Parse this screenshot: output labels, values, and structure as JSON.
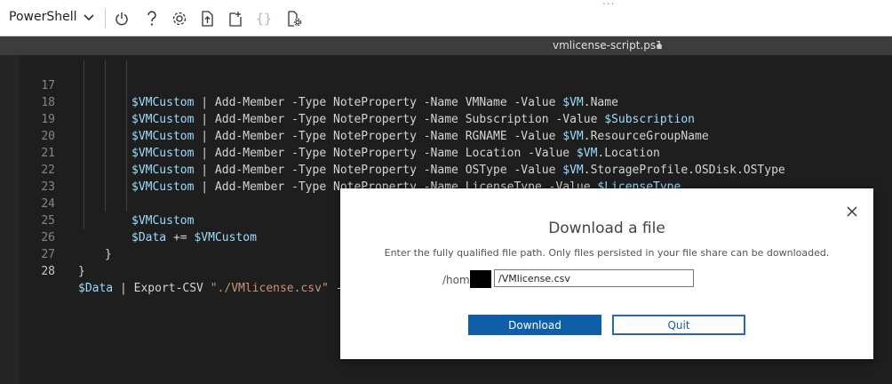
{
  "toolbar": {
    "shell_label": "PowerShell",
    "icons": [
      "power-icon",
      "help-icon",
      "settings-icon",
      "upload-file-icon",
      "download-file-icon",
      "braces-icon",
      "open-editor-icon"
    ]
  },
  "editor": {
    "tab_title": "vmlicense-script.ps1",
    "lines": [
      {
        "num": "17",
        "text": "$VMCustom | Add-Member -Type NoteProperty -Name VMName -Value $VM.Name"
      },
      {
        "num": "18",
        "text": "$VMCustom | Add-Member -Type NoteProperty -Name Subscription -Value $Subscription"
      },
      {
        "num": "19",
        "text": "$VMCustom | Add-Member -Type NoteProperty -Name RGNAME -Value $VM.ResourceGroupName"
      },
      {
        "num": "20",
        "text": "$VMCustom | Add-Member -Type NoteProperty -Name Location -Value $VM.Location"
      },
      {
        "num": "21",
        "text": "$VMCustom | Add-Member -Type NoteProperty -Name OSType -Value $VM.StorageProfile.OSDisk.OSType"
      },
      {
        "num": "22",
        "text": "$VMCustom | Add-Member -Type NoteProperty -Name LicenseType -Value $LicenseType"
      },
      {
        "num": "23",
        "text": ""
      },
      {
        "num": "24",
        "text": "$VMCustom"
      },
      {
        "num": "25",
        "text": "$Data += $VMCustom"
      },
      {
        "num": "26",
        "text": "}"
      },
      {
        "num": "27",
        "text": "}"
      },
      {
        "num": "28",
        "text": "$Data | Export-CSV \"./VMlicense.csv\" -D"
      }
    ]
  },
  "dialog": {
    "title": "Download a file",
    "description": "Enter the fully qualified file path. Only files persisted in your file share can be downloaded.",
    "path_prefix": "/hom",
    "path_value": "/VMlicense.csv",
    "download_label": "Download",
    "quit_label": "Quit"
  },
  "colors": {
    "editor_bg": "#1e1e1e",
    "variable": "#9cdcfe",
    "string": "#ce9178",
    "download_button": "#0f5fa8"
  }
}
